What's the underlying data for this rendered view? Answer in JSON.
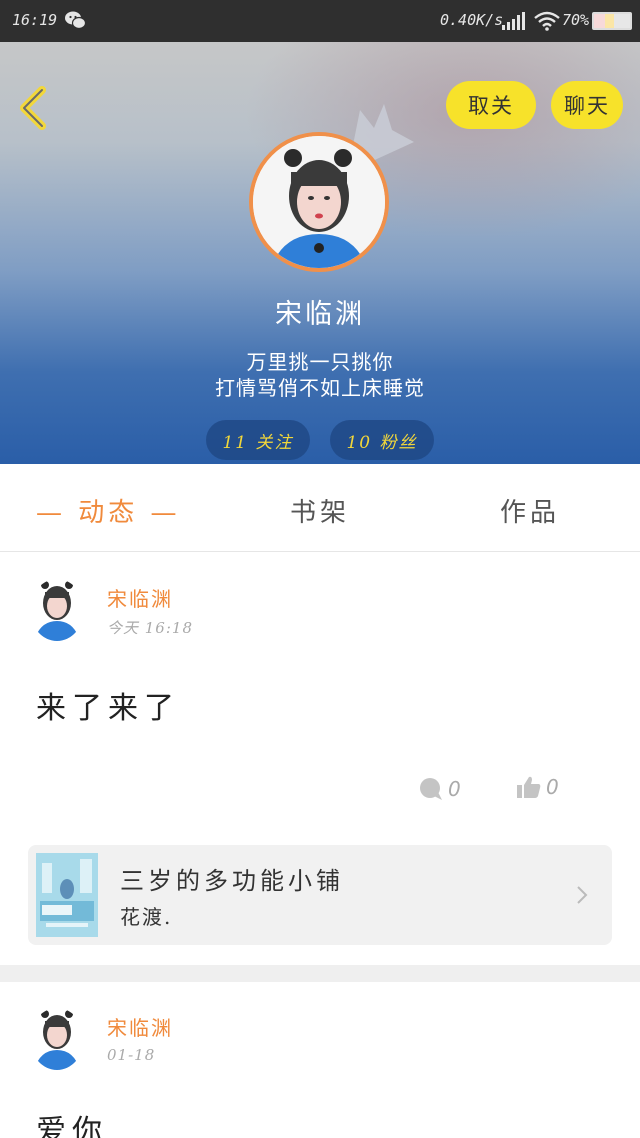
{
  "status_bar": {
    "time": "16:19",
    "net_speed": "0.40K/s",
    "battery": "70%"
  },
  "header": {
    "unfollow_label": "取关",
    "chat_label": "聊天",
    "user_name": "宋临渊",
    "bio_line_1": "万里挑一只挑你",
    "bio_line_2": "打情骂俏不如上床睡觉",
    "following_label": "11 关注",
    "fans_label": "10 粉丝"
  },
  "tabs": [
    {
      "label": "— 动态 —",
      "active": true
    },
    {
      "label": "书架",
      "active": false
    },
    {
      "label": "作品",
      "active": false
    }
  ],
  "posts": [
    {
      "author": "宋临渊",
      "time": "今天 16:18",
      "content": "来了来了",
      "comments": "0",
      "likes": "0",
      "book": {
        "title": "三岁的多功能小铺",
        "author": "花渡."
      }
    },
    {
      "author": "宋临渊",
      "time": "01-18",
      "content": "爱你"
    }
  ],
  "colors": {
    "accent": "#f08a3c",
    "button_yellow": "#f7e22a",
    "stat_text": "#f2d73a"
  }
}
